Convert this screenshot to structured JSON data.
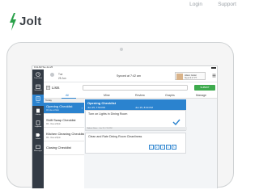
{
  "brand": {
    "name": "Jolt",
    "accent": "#2b83cf",
    "logo_mark_color": "#2aa14a"
  },
  "top_nav": {
    "login_label": "Login",
    "support_label": "Support"
  },
  "device": {
    "status": {
      "time": "9:41 AM Tue Jun 25"
    },
    "header": {
      "weather_icon": "weather-icon",
      "date_dow": "Tue",
      "date_day": "25 Jun",
      "synced_text": "Synced at 7:42 am",
      "profile_name": "Alison Carter",
      "profile_sub": "Sig at 9:17 PT",
      "menu_icon": "hamburger-icon"
    },
    "rail": [
      {
        "label": "Timeclock",
        "icon": "clock-icon"
      },
      {
        "label": "Schedule",
        "icon": "calendar-icon"
      },
      {
        "label": "Lists",
        "icon": "list-icon"
      },
      {
        "label": "Library",
        "icon": "book-icon"
      },
      {
        "label": "Logbook",
        "icon": "logbook-icon"
      },
      {
        "label": "Labels",
        "icon": "label-icon"
      },
      {
        "label": "Messages",
        "icon": "message-icon"
      }
    ],
    "lists_bar": {
      "title": "Lists",
      "search_placeholder": "",
      "submit_label": "SUBMIT"
    },
    "tabs": [
      "All",
      "Mine",
      "Review",
      "Graphs",
      "Manage"
    ],
    "active_tab": "All",
    "left_list": {
      "section_label": "Today",
      "rows": [
        {
          "title": "Opening Checklist",
          "meta": "0/4 due at 9am",
          "active": true
        },
        {
          "title": "Shift Swap Checklist",
          "meta": "0/4 · Due at 5pm",
          "active": false
        },
        {
          "title": "Kitchen Cleaning Checklist",
          "meta": "0/4 · Due at 5pm",
          "active": false
        },
        {
          "title": "Closing Checklist",
          "meta": "",
          "active": false
        }
      ]
    },
    "detail": {
      "title": "Opening Checklist",
      "date_left": "Jun 25, 7:50 PM",
      "date_right": "Jun 25, 8:00 PM",
      "tasks": [
        {
          "title": "Turn on Lights in Dining Room",
          "footer": "Admin Notes · Jun 25, 7:50 PM",
          "done": true
        },
        {
          "title": "Clean and Rate Dining Room Cleanliness",
          "footer": "Admin Notes · Jun 25, 7:50 PM",
          "done": false
        }
      ],
      "pagination": [
        "1",
        "2",
        "3",
        "4",
        "5"
      ]
    }
  }
}
